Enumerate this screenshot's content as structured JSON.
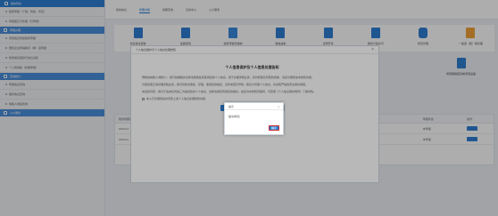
{
  "sidebar": {
    "header": "我的待办",
    "section1": "申报办理",
    "section2": "查询统计",
    "section3": "公众服务",
    "items": [
      "税费申报（个税、附加、印花）",
      "申报更正与作废（已申报）",
      "增值税及附加税费申报",
      "居民企业所得税月（季）度申报",
      "财务报表报送与信息采集",
      "个人所得税（扣缴申报）",
      "申报信息查询",
      "缴款信息查询",
      "纳税人档案查询"
    ]
  },
  "tabs": [
    "我的信息",
    "我要办税",
    "我要查询",
    "互动中心",
    "公众服务"
  ],
  "active_tab": 1,
  "tiles": [
    "综合信息报告",
    "发票使用",
    "税费申报及缴纳",
    "税收减免",
    "证明开具",
    "税务行政许可",
    "核定管理",
    "一般退（抵）税管理"
  ],
  "mid_tile": "增值税税控系统专用设备",
  "table": {
    "headers": [
      "税款所属期",
      "税（费）种",
      "申报状态",
      "操作"
    ],
    "rows": [
      [
        "2022-01",
        "个人所得税",
        "未申报",
        ""
      ],
      [
        "2022-01",
        "城市维护建设税",
        "未申报",
        ""
      ]
    ]
  },
  "modal": {
    "title": "个人信息保护与个人信息处理告知",
    "doc_title": "个人信息保护及个人信息处理告知",
    "para1": "尊敬的纳税人/缴费人：我们依据相关法律法规收集和使用您的个人信息，用于办理涉税业务、身份核验及风险防控等，请您仔细阅读本告知内容。",
    "para2": "为使您能正常办理涉税业务，我们将依法收集、存储、使用您的姓名、证件类型及号码、联系方式等个人信息，并采取严格的安全保护措施。",
    "para3": "未经您同意，我们不会向任何第三方提供您的个人信息，法律法规另有规定的除外。如您对本告知有疑问，可查阅《个人信息保护规则》了解详情。",
    "agree_text": "本人已仔细阅读并同意上述个人信息处理告知内容",
    "confirm_label": "我已阅读并同意",
    "cancel_label": "不同意"
  },
  "dialog": {
    "title": "提示",
    "message": "提交成功！",
    "ok_label": "确定"
  }
}
